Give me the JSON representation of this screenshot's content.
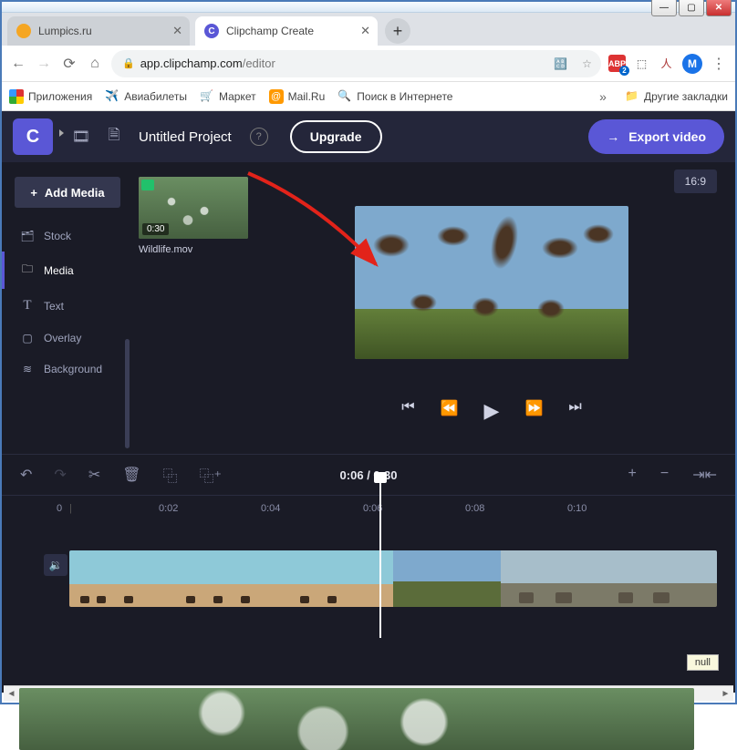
{
  "window": {
    "titlebar_min": "—",
    "titlebar_max": "▢",
    "titlebar_close": "✕"
  },
  "tabs": {
    "tab1_label": "Lumpics.ru",
    "tab2_label": "Clipchamp Create",
    "tab2_initial": "C"
  },
  "addressbar": {
    "url_host": "app.clipchamp.com",
    "url_path": "/editor",
    "abp_label": "ABP",
    "avatar_initial": "M"
  },
  "bookmarks": {
    "apps": "Приложения",
    "avia": "Авиабилеты",
    "market": "Маркет",
    "mail": "Mail.Ru",
    "search": "Поиск в Интернете",
    "other": "Другие закладки"
  },
  "app": {
    "logo_text": "C",
    "project_title": "Untitled Project",
    "upgrade_label": "Upgrade",
    "export_label": "Export video"
  },
  "sidebar": {
    "add_media": "Add Media",
    "stock": "Stock",
    "media": "Media",
    "text": "Text",
    "overlay": "Overlay",
    "background": "Background"
  },
  "mediapanel": {
    "thumb_duration": "0:30",
    "thumb_name": "Wildlife.mov"
  },
  "preview": {
    "aspect": "16:9"
  },
  "timeline": {
    "time_current": "0:06",
    "time_sep": " / ",
    "time_total": "0:30",
    "ruler": [
      "0",
      "0:02",
      "0:04",
      "0:06",
      "0:08",
      "0:10"
    ]
  },
  "misc": {
    "null_label": "null"
  }
}
